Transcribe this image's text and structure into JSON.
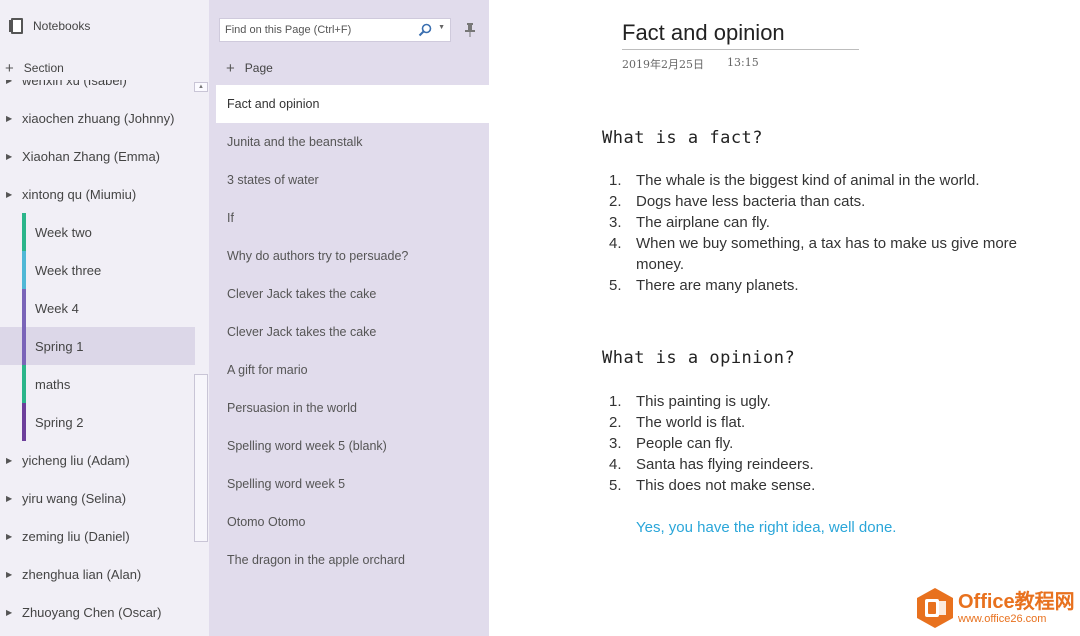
{
  "sections_pane": {
    "notebooks_label": "Notebooks",
    "add_section_label": "Section",
    "items": [
      {
        "type": "group",
        "label": "wenxin xu (Isabel)"
      },
      {
        "type": "group",
        "label": "xiaochen zhuang (Johnny)"
      },
      {
        "type": "group",
        "label": "Xiaohan Zhang (Emma)"
      },
      {
        "type": "group",
        "label": "xintong qu (Miumiu)"
      },
      {
        "type": "section",
        "label": "Week two",
        "color": "#2bb58a"
      },
      {
        "type": "section",
        "label": "Week three",
        "color": "#4fb8d6"
      },
      {
        "type": "section",
        "label": "Week 4",
        "color": "#7a64b8"
      },
      {
        "type": "section",
        "label": "Spring 1",
        "color": "#7a64b8",
        "selected": true
      },
      {
        "type": "section",
        "label": "maths",
        "color": "#2bb58a"
      },
      {
        "type": "section",
        "label": "Spring 2",
        "color": "#6d3f9b"
      },
      {
        "type": "group",
        "label": "yicheng liu (Adam)"
      },
      {
        "type": "group",
        "label": "yiru wang (Selina)"
      },
      {
        "type": "group",
        "label": "zeming liu (Daniel)"
      },
      {
        "type": "group",
        "label": "zhenghua lian (Alan)"
      },
      {
        "type": "group",
        "label": "Zhuoyang Chen (Oscar)"
      }
    ]
  },
  "pages_pane": {
    "search_placeholder": "Find on this Page (Ctrl+F)",
    "add_page_label": "Page",
    "pages": [
      "Fact and opinion",
      "Junita and the beanstalk",
      "3 states of water",
      "If",
      "Why do authors try to persuade?",
      "Clever Jack takes the cake",
      "Clever Jack takes the cake",
      "A gift for mario",
      "Persuasion in the world",
      "Spelling word week 5 (blank)",
      "Spelling word week 5",
      "Otomo Otomo",
      "The dragon in the apple orchard"
    ],
    "active_page_index": 0
  },
  "note": {
    "title": "Fact and opinion",
    "date": "2019年2月25日",
    "time": "13:15",
    "fact_heading": "What is a fact?",
    "facts": [
      {
        "num": "1.",
        "text": "The whale is the biggest kind of animal in the world."
      },
      {
        "num": "2.",
        "text": "Dogs have less bacteria than cats."
      },
      {
        "num": "3.",
        "text": "The airplane can fly."
      },
      {
        "num": "4.",
        "text": "When we buy something, a tax has to make us give more money."
      },
      {
        "num": "5.",
        "text": "There are many planets."
      }
    ],
    "opinion_heading": "What is a opinion?",
    "opinions": [
      {
        "num": "1.",
        "text": "This painting is ugly."
      },
      {
        "num": "2.",
        "text": "The world is flat."
      },
      {
        "num": "3.",
        "text": "People can fly."
      },
      {
        "num": "4.",
        "text": "Santa has flying reindeers."
      },
      {
        "num": "5.",
        "text": "This does not make sense."
      }
    ],
    "feedback": "Yes, you have the right idea, well done.",
    "feedback_color": "#2aa6d9"
  },
  "watermark": {
    "brand": "Office教程网",
    "url": "www.office26.com",
    "color": "#e8711e"
  }
}
